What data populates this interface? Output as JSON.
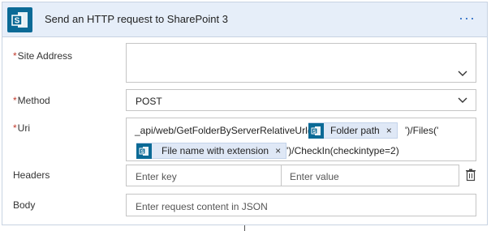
{
  "card": {
    "title": "Send an HTTP request to SharePoint 3",
    "menu": "···",
    "icon": "sharepoint-icon"
  },
  "fields": {
    "site_address": {
      "label": "Site Address",
      "required": "*",
      "value": ""
    },
    "method": {
      "label": "Method",
      "required": "*",
      "value": "POST"
    },
    "uri": {
      "label": "Uri",
      "required": "*",
      "text_1": "_api/web/GetFolderByServerRelativeUrl('",
      "token_1": "Folder path",
      "text_2": "')/Files('",
      "token_2": "File name with extension",
      "text_3": "')/CheckIn(checkintype=2)"
    },
    "headers": {
      "label": "Headers",
      "key_placeholder": "Enter key",
      "value_placeholder": "Enter value"
    },
    "body": {
      "label": "Body",
      "placeholder": "Enter request content in JSON"
    }
  },
  "token_close": "×",
  "colors": {
    "sharepoint_blue": "#0b6a96",
    "header_bg": "#e6eef9",
    "token_bg": "#dfe8f6",
    "required": "#c0392b",
    "accent": "#2b6cc4"
  }
}
